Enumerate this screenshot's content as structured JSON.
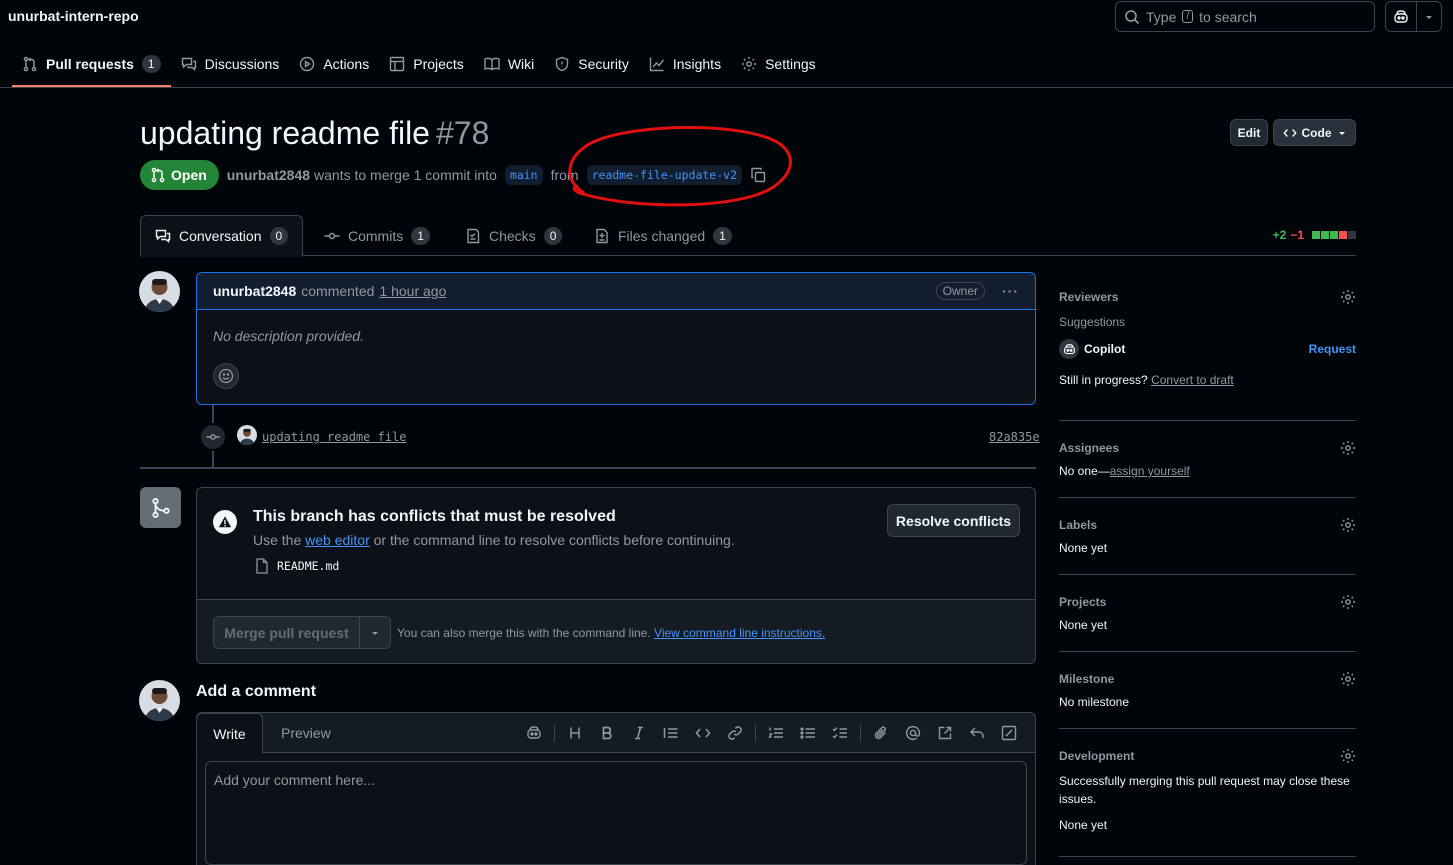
{
  "repo": {
    "name": "unurbat-intern-repo"
  },
  "search": {
    "prefix": "Type",
    "key": "/",
    "suffix": "to search"
  },
  "nav": {
    "items": [
      {
        "label": "Pull requests",
        "count": "1",
        "icon": "git-pull-request-icon",
        "active": true
      },
      {
        "label": "Discussions",
        "icon": "comment-discussion-icon"
      },
      {
        "label": "Actions",
        "icon": "play-icon"
      },
      {
        "label": "Projects",
        "icon": "table-icon"
      },
      {
        "label": "Wiki",
        "icon": "book-icon"
      },
      {
        "label": "Security",
        "icon": "shield-icon"
      },
      {
        "label": "Insights",
        "icon": "graph-icon"
      },
      {
        "label": "Settings",
        "icon": "gear-icon"
      }
    ]
  },
  "pr": {
    "title": "updating readme file",
    "number": "#78",
    "state": "Open",
    "author": "unurbat2848",
    "merge_text": "wants to merge 1 commit into",
    "base_branch": "main",
    "from_text": "from",
    "head_branch": "readme-file-update-v2",
    "edit_label": "Edit",
    "code_label": "Code"
  },
  "tabs": [
    {
      "label": "Conversation",
      "count": "0",
      "icon": "comment-discussion-icon"
    },
    {
      "label": "Commits",
      "count": "1",
      "icon": "git-commit-icon"
    },
    {
      "label": "Checks",
      "count": "0",
      "icon": "checklist-icon"
    },
    {
      "label": "Files changed",
      "count": "1",
      "icon": "file-diff-icon"
    }
  ],
  "diffstat": {
    "additions": "+2",
    "deletions": "−1",
    "blocks": [
      "#3fb950",
      "#3fb950",
      "#3fb950",
      "#f85149",
      "#2f363d"
    ]
  },
  "comment": {
    "author": "unurbat2848",
    "action": "commented",
    "time": "1 hour ago",
    "badge": "Owner",
    "body": "No description provided."
  },
  "commit": {
    "message": "updating readme file",
    "sha": "82a835e"
  },
  "merge": {
    "conflict_title": "This branch has conflicts that must be resolved",
    "desc_prefix": "Use the",
    "desc_link": "web editor",
    "desc_suffix": "or the command line to resolve conflicts before continuing.",
    "file": "README.md",
    "resolve_label": "Resolve conflicts",
    "merge_label": "Merge pull request",
    "hint_prefix": "You can also merge this with the command line.",
    "hint_link": "View command line instructions."
  },
  "add_comment": {
    "title": "Add a comment",
    "tab_write": "Write",
    "tab_preview": "Preview",
    "placeholder": "Add your comment here..."
  },
  "sidebar": {
    "reviewers": {
      "title": "Reviewers",
      "suggestions": "Suggestions",
      "copilot": "Copilot",
      "request": "Request",
      "draft_prefix": "Still in progress?",
      "draft_link": "Convert to draft"
    },
    "assignees": {
      "title": "Assignees",
      "prefix": "No one—",
      "link": "assign yourself"
    },
    "labels": {
      "title": "Labels",
      "value": "None yet"
    },
    "projects": {
      "title": "Projects",
      "value": "None yet"
    },
    "milestone": {
      "title": "Milestone",
      "value": "No milestone"
    },
    "development": {
      "title": "Development",
      "desc": "Successfully merging this pull request may close these issues.",
      "value": "None yet"
    }
  },
  "colors": {
    "background": "#010409",
    "accent_link": "#4493f8",
    "open_green": "#238636",
    "nav_underline": "#f78166",
    "annotation_red": "#e01010"
  }
}
